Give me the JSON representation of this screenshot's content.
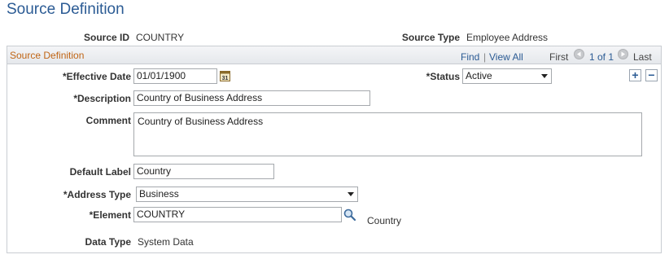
{
  "page": {
    "title": "Source Definition"
  },
  "header_fields": {
    "source_id_label": "Source ID",
    "source_id_value": "COUNTRY",
    "source_type_label": "Source Type",
    "source_type_value": "Employee Address"
  },
  "panel": {
    "title": "Source Definition",
    "nav": {
      "find": "Find",
      "separator": "|",
      "view_all": "View All",
      "first": "First",
      "position": "1 of 1",
      "last": "Last"
    },
    "add_row": "+",
    "delete_row": "−"
  },
  "form": {
    "effective_date_label": "*Effective Date",
    "effective_date_value": "01/01/1900",
    "status_label": "*Status",
    "status_value": "Active",
    "description_label": "*Description",
    "description_value": "Country of Business Address",
    "comment_label": "Comment",
    "comment_value": "Country of Business Address",
    "default_label_label": "Default Label",
    "default_label_value": "Country",
    "address_type_label": "*Address Type",
    "address_type_value": "Business",
    "element_label": "*Element",
    "element_value": "COUNTRY",
    "element_description": "Country",
    "data_type_label": "Data Type",
    "data_type_value": "System Data"
  },
  "icons": {
    "calendar": "calendar-icon",
    "lookup": "magnifier-icon",
    "nav_prev": "triangle-left-icon",
    "nav_next": "triangle-right-icon"
  }
}
